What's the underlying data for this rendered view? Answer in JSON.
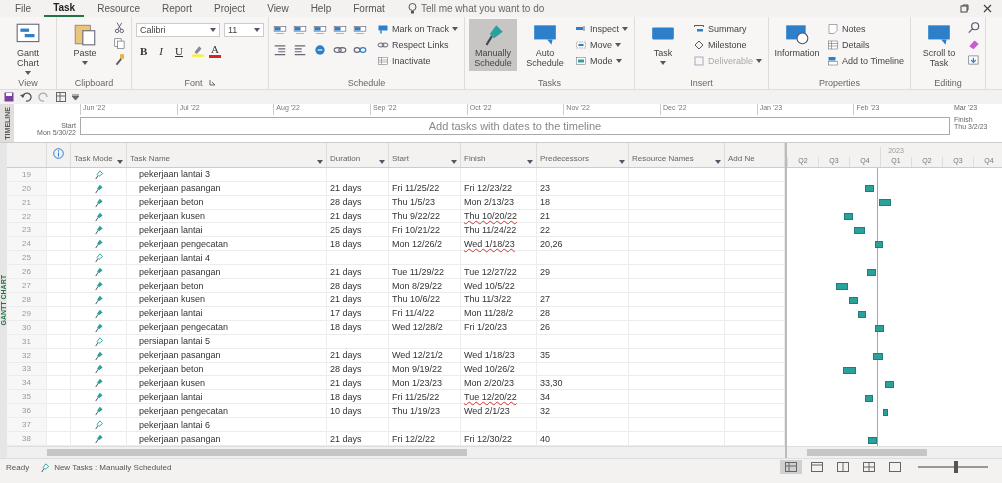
{
  "ribbon_tabs": [
    {
      "label": "File",
      "selected": false
    },
    {
      "label": "Task",
      "selected": true
    },
    {
      "label": "Resource",
      "selected": false
    },
    {
      "label": "Report",
      "selected": false
    },
    {
      "label": "Project",
      "selected": false
    },
    {
      "label": "View",
      "selected": false
    },
    {
      "label": "Help",
      "selected": false
    },
    {
      "label": "Format",
      "selected": false
    }
  ],
  "tell_me": {
    "placeholder": "Tell me what you want to do"
  },
  "ribbon_groups": [
    {
      "kind": "view",
      "label": "View",
      "items": [
        {
          "kind": "large",
          "label": "Gantt Chart",
          "dropdown": true,
          "selected": false
        }
      ]
    },
    {
      "kind": "clipboard",
      "label": "Clipboard",
      "items": [
        {
          "kind": "large",
          "label": "Paste",
          "dropdown": true,
          "selected": false
        },
        {
          "kind": "tool"
        },
        {
          "kind": "tool"
        },
        {
          "kind": "tool"
        }
      ]
    },
    {
      "kind": "font",
      "label": "Font",
      "items": [
        {
          "kind": "field",
          "value": "Calibri"
        },
        {
          "kind": "field",
          "value": "11"
        },
        {
          "kind": "letter",
          "label": "B"
        },
        {
          "kind": "letter",
          "label": "I"
        },
        {
          "kind": "letter",
          "label": "U"
        },
        {
          "kind": "tool"
        },
        {
          "kind": "letter",
          "label": "A"
        }
      ]
    },
    {
      "kind": "schedule",
      "label": "Schedule",
      "items": [
        {
          "kind": "tool"
        },
        {
          "kind": "tool"
        },
        {
          "kind": "tool"
        },
        {
          "kind": "tool"
        },
        {
          "kind": "tool"
        },
        {
          "kind": "tool"
        },
        {
          "kind": "tool"
        },
        {
          "kind": "tool"
        },
        {
          "kind": "tool"
        },
        {
          "kind": "tool"
        },
        {
          "kind": "small",
          "label": "Mark on Track",
          "dropdown": true,
          "disabled": false
        },
        {
          "kind": "small",
          "label": "Respect Links",
          "dropdown": false,
          "disabled": false
        },
        {
          "kind": "small",
          "label": "Inactivate",
          "dropdown": false,
          "disabled": false
        }
      ]
    },
    {
      "kind": "tasks",
      "label": "Tasks",
      "items": [
        {
          "kind": "large",
          "label": "Manually Schedule",
          "dropdown": false,
          "selected": true
        },
        {
          "kind": "large",
          "label": "Auto Schedule",
          "dropdown": false,
          "selected": false
        },
        {
          "kind": "small",
          "label": "Inspect",
          "dropdown": true,
          "disabled": false
        },
        {
          "kind": "small",
          "label": "Move",
          "dropdown": true,
          "disabled": false
        },
        {
          "kind": "small",
          "label": "Mode",
          "dropdown": true,
          "disabled": false
        }
      ]
    },
    {
      "kind": "insert",
      "label": "Insert",
      "items": [
        {
          "kind": "large",
          "label": "Task",
          "dropdown": true,
          "selected": false
        },
        {
          "kind": "small",
          "label": "Summary",
          "dropdown": false,
          "disabled": false
        },
        {
          "kind": "small",
          "label": "Milestone",
          "dropdown": false,
          "disabled": false
        },
        {
          "kind": "small",
          "label": "Deliverable",
          "dropdown": true,
          "disabled": true
        }
      ]
    },
    {
      "kind": "properties",
      "label": "Properties",
      "items": [
        {
          "kind": "large",
          "label": "Information",
          "dropdown": false,
          "selected": false
        },
        {
          "kind": "small",
          "label": "Notes",
          "dropdown": false,
          "disabled": false
        },
        {
          "kind": "small",
          "label": "Details",
          "dropdown": false,
          "disabled": false
        },
        {
          "kind": "small",
          "label": "Add to Timeline",
          "dropdown": false,
          "disabled": false
        }
      ]
    },
    {
      "kind": "editing",
      "label": "Editing",
      "items": [
        {
          "kind": "large",
          "label": "Scroll to Task",
          "dropdown": false,
          "selected": false
        },
        {
          "kind": "tool"
        },
        {
          "kind": "tool"
        },
        {
          "kind": "tool"
        }
      ]
    }
  ],
  "timeline": {
    "label": "TIMELINE",
    "start_label": "Start",
    "start_date": "Mon 5/30/22",
    "months": [
      "Jun '22",
      "Jul '22",
      "Aug '22",
      "Sep '22",
      "Oct '22",
      "Nov '22",
      "Dec '22",
      "Jan '23",
      "Feb '23"
    ],
    "end_month": "Mar '23",
    "placeholder": "Add tasks with dates to the timeline",
    "finish_label": "Finish",
    "finish_date": "Thu 3/2/23"
  },
  "view_label": "GANTT CHART",
  "columns": [
    {
      "label": "Task Mode"
    },
    {
      "label": "Task Name"
    },
    {
      "label": "Duration"
    },
    {
      "label": "Start"
    },
    {
      "label": "Finish"
    },
    {
      "label": "Predecessors"
    },
    {
      "label": "Resource Names"
    },
    {
      "label": "Add Ne"
    }
  ],
  "rows": [
    {
      "id": "19",
      "kind": "summary",
      "name": "pekerjaan lantai 3"
    },
    {
      "id": "20",
      "kind": "task",
      "name": "pekerjaan pasangan",
      "duration": "21 days",
      "start": "Fri 11/25/22",
      "finish": "Fri 12/23/22",
      "predecessors": "23",
      "finish_flagged": false
    },
    {
      "id": "21",
      "kind": "task",
      "name": "pekerjaan beton",
      "duration": "28 days",
      "start": "Thu 1/5/23",
      "finish": "Mon 2/13/23",
      "predecessors": "18",
      "finish_flagged": false
    },
    {
      "id": "22",
      "kind": "task",
      "name": "pekerjaan kusen",
      "duration": "21 days",
      "start": "Thu 9/22/22",
      "finish": "Thu 10/20/22",
      "predecessors": "21",
      "finish_flagged": true
    },
    {
      "id": "23",
      "kind": "task",
      "name": "pekerjaan lantai",
      "duration": "25 days",
      "start": "Fri 10/21/22",
      "finish": "Thu 11/24/22",
      "predecessors": "22",
      "finish_flagged": false
    },
    {
      "id": "24",
      "kind": "task",
      "name": "pekerjaan pengecatan",
      "duration": "18 days",
      "start": "Mon 12/26/2",
      "finish": "Wed 1/18/23",
      "predecessors": "20,26",
      "finish_flagged": true
    },
    {
      "id": "25",
      "kind": "summary",
      "name": "pekerjaan lantai 4"
    },
    {
      "id": "26",
      "kind": "task",
      "name": "pekerjaan pasangan",
      "duration": "21 days",
      "start": "Tue 11/29/22",
      "finish": "Tue 12/27/22",
      "predecessors": "29",
      "finish_flagged": false
    },
    {
      "id": "27",
      "kind": "task",
      "name": "pekerjaan beton",
      "duration": "28 days",
      "start": "Mon 8/29/22",
      "finish": "Wed 10/5/22",
      "finish_flagged": false
    },
    {
      "id": "28",
      "kind": "task",
      "name": "pekerjaan kusen",
      "duration": "21 days",
      "start": "Thu 10/6/22",
      "finish": "Thu 11/3/22",
      "predecessors": "27",
      "finish_flagged": false
    },
    {
      "id": "29",
      "kind": "task",
      "name": "pekerjaan lantai",
      "duration": "17 days",
      "start": "Fri 11/4/22",
      "finish": "Mon 11/28/2",
      "predecessors": "28",
      "finish_flagged": false
    },
    {
      "id": "30",
      "kind": "task",
      "name": "pekerjaan pengecatan",
      "duration": "18 days",
      "start": "Wed 12/28/2",
      "finish": "Fri 1/20/23",
      "predecessors": "26",
      "finish_flagged": false
    },
    {
      "id": "31",
      "kind": "summary",
      "name": "persiapan lantai 5"
    },
    {
      "id": "32",
      "kind": "task",
      "name": "pekerjaan pasangan",
      "duration": "21 days",
      "start": "Wed 12/21/2",
      "finish": "Wed 1/18/23",
      "predecessors": "35",
      "finish_flagged": false
    },
    {
      "id": "33",
      "kind": "task",
      "name": "pekerjaan beton",
      "duration": "28 days",
      "start": "Mon 9/19/22",
      "finish": "Wed 10/26/2",
      "finish_flagged": false
    },
    {
      "id": "34",
      "kind": "task",
      "name": "pekerjaan kusen",
      "duration": "21 days",
      "start": "Mon 1/23/23",
      "finish": "Mon 2/20/23",
      "predecessors": "33,30",
      "finish_flagged": false
    },
    {
      "id": "35",
      "kind": "task",
      "name": "pekerjaan lantai",
      "duration": "18 days",
      "start": "Fri 11/25/22",
      "finish": "Tue 12/20/22",
      "predecessors": "34",
      "finish_flagged": true
    },
    {
      "id": "36",
      "kind": "task",
      "name": "pekerjaan pengecatan",
      "duration": "10 days",
      "start": "Thu 1/19/23",
      "finish": "Wed 2/1/23",
      "predecessors": "32",
      "finish_flagged": false
    },
    {
      "id": "37",
      "kind": "summary",
      "name": "pekerjaan lantai 6"
    },
    {
      "id": "38",
      "kind": "task",
      "name": "pekerjaan pasangan",
      "duration": "21 days",
      "start": "Fri 12/2/22",
      "finish": "Fri 12/30/22",
      "predecessors": "40",
      "finish_flagged": false
    }
  ],
  "gantt": {
    "quarters": [
      {
        "label": "Q2"
      },
      {
        "label": "Q3"
      },
      {
        "label": "Q4"
      },
      {
        "label": "Q1",
        "year": "2023"
      },
      {
        "label": "Q2"
      },
      {
        "label": "Q3"
      },
      {
        "label": "Q4"
      }
    ]
  },
  "status_bar": {
    "ready": "Ready",
    "new_tasks": "New Tasks : Manually Scheduled",
    "views": [
      {
        "selected": true
      },
      {
        "selected": false
      },
      {
        "selected": false
      },
      {
        "selected": false
      },
      {
        "selected": false
      }
    ],
    "zoom": {
      "level": 0.55
    }
  }
}
